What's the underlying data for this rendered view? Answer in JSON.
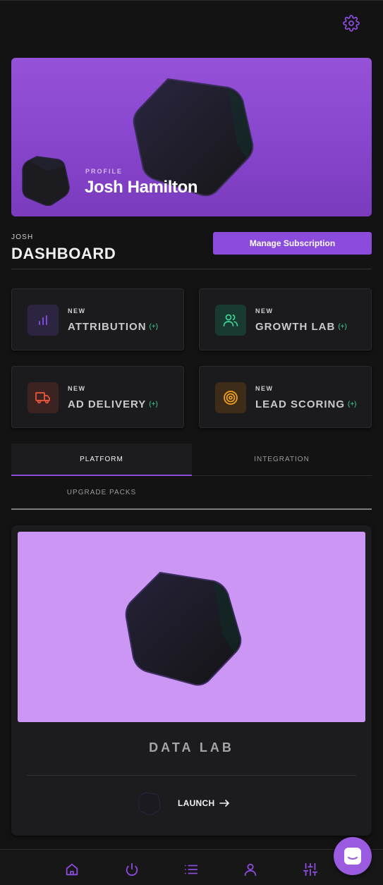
{
  "colors": {
    "accent": "#8b4bdc",
    "hero_bg": "#8a47d0",
    "lab_bg": "#cc97f4",
    "positive": "#3ed598"
  },
  "header": {
    "settings_icon": "gear-icon"
  },
  "hero": {
    "eyebrow": "PROFILE",
    "name": "Josh Hamilton"
  },
  "dashboard": {
    "eyebrow": "JOSH",
    "title": "DASHBOARD",
    "manage_label": "Manage Subscription"
  },
  "features": [
    {
      "badge": "NEW",
      "label": "ATTRIBUTION",
      "plus": "(+)",
      "icon": "bar-chart-icon",
      "color": "#7c4bd6"
    },
    {
      "badge": "NEW",
      "label": "GROWTH LAB",
      "plus": "(+)",
      "icon": "users-icon",
      "color": "#3ed598"
    },
    {
      "badge": "NEW",
      "label": "AD DELIVERY",
      "plus": "(+)",
      "icon": "truck-icon",
      "color": "#f0583a"
    },
    {
      "badge": "NEW",
      "label": "LEAD SCORING",
      "plus": "(+)",
      "icon": "target-icon",
      "color": "#f0a020"
    }
  ],
  "tabs": [
    {
      "label": "PLATFORM",
      "active": true
    },
    {
      "label": "INTEGRATION",
      "active": false
    },
    {
      "label": "UPGRADE PACKS",
      "active": false
    }
  ],
  "lab": {
    "title": "DATA LAB",
    "launch_label": "LAUNCH"
  },
  "bottom_nav": [
    "home-icon",
    "power-icon",
    "list-icon",
    "user-icon",
    "sliders-icon"
  ],
  "chat": {
    "icon": "chat-icon"
  }
}
